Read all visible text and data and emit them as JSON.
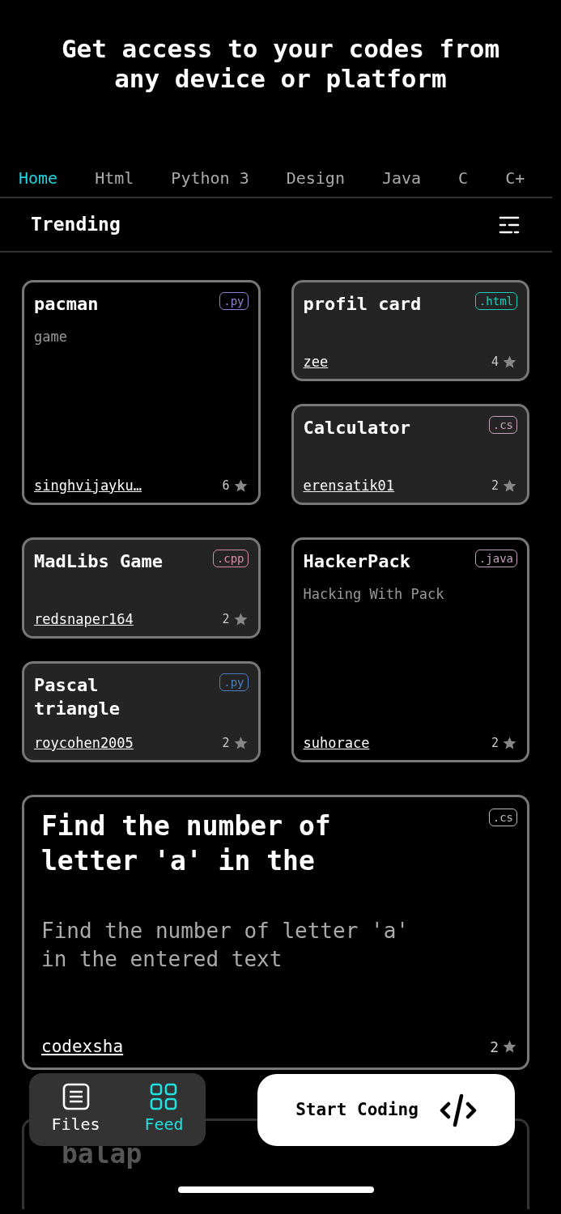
{
  "headline": "Get access to your codes from any device or platform",
  "tabs": [
    {
      "label": "Home",
      "selected": true
    },
    {
      "label": "Html",
      "selected": false
    },
    {
      "label": "Python 3",
      "selected": false
    },
    {
      "label": "Design",
      "selected": false
    },
    {
      "label": "Java",
      "selected": false
    },
    {
      "label": "C",
      "selected": false
    },
    {
      "label": "C+",
      "selected": false
    }
  ],
  "section_title": "Trending",
  "grid_rows": [
    {
      "columns": [
        [
          {
            "title": "pacman",
            "description": "game",
            "tag": ".py",
            "color": "#8f84d6",
            "author": "singhvijayku…",
            "likes": "6",
            "shaded": false
          }
        ],
        [
          {
            "title": "profil card",
            "tag": ".html",
            "color": "#1fcdb9",
            "author": "zee",
            "likes": "4",
            "shaded": true
          },
          {
            "title": "Calculator",
            "tag": ".cs",
            "color": "#c6a2b9",
            "author": "erensatik01",
            "likes": "2",
            "shaded": true
          }
        ]
      ]
    },
    {
      "columns": [
        [
          {
            "title": "MadLibs Game",
            "tag": ".cpp",
            "color": "#d98ea6",
            "author": "redsnaper164",
            "likes": "2",
            "shaded": true
          },
          {
            "title": "Pascal triangle",
            "tag": ".py",
            "color": "#4d7fc2",
            "author": "roycohen2005",
            "likes": "2",
            "shaded": true
          }
        ],
        [
          {
            "title": "HackerPack",
            "description": "Hacking With Pack",
            "tag": ".java",
            "color": "#c8a0c4",
            "author": "suhorace",
            "likes": "2",
            "shaded": false
          }
        ]
      ]
    }
  ],
  "featured": {
    "title": "Find the number of letter 'a' in the",
    "description": "Find the number of letter 'a' in the entered text",
    "tag": ".cs",
    "color": "#bbbbbb",
    "author": "codexsha",
    "likes": "2"
  },
  "next_card": {
    "title": "balap"
  },
  "bottom_nav": [
    {
      "label": "Files",
      "selected": false
    },
    {
      "label": "Feed",
      "selected": true
    }
  ],
  "start_button": "Start Coding"
}
